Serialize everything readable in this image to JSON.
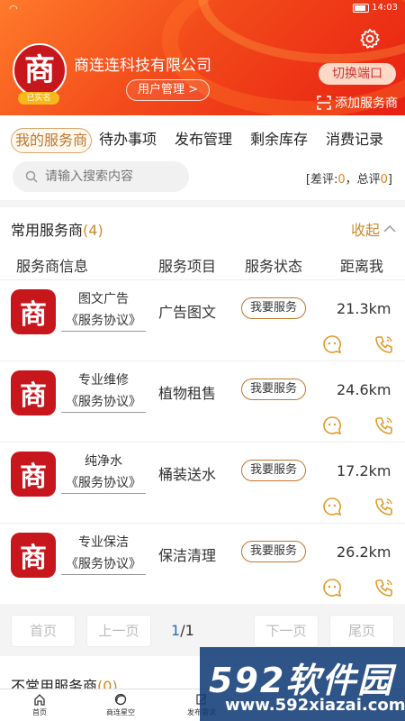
{
  "statusbar": {
    "time": "14:03"
  },
  "header": {
    "company_name": "商连连科技有限公司",
    "logo_char": "商",
    "verified_label": "已实名",
    "role_button": "用户管理 >",
    "switch_button": "切换端口",
    "add_provider": "添加服务商"
  },
  "tabs": [
    {
      "label": "我的服务商",
      "active": true
    },
    {
      "label": "待办事项"
    },
    {
      "label": "发布管理"
    },
    {
      "label": "剩余库存"
    },
    {
      "label": "消费记录"
    }
  ],
  "search": {
    "placeholder": "请输入搜索内容",
    "eval_prefix": "[差评:",
    "bad_count": "0",
    "eval_mid": "，总评",
    "total_count": "0",
    "eval_suffix": "]"
  },
  "common_section": {
    "title": "常用服务商",
    "count_text": "(4)",
    "collapse_label": "收起",
    "columns": [
      "服务商信息",
      "服务项目",
      "服务状态",
      "距离我"
    ],
    "rows": [
      {
        "logo_char": "商",
        "name": "图文广告",
        "agreement": "《服务协议》",
        "service": "广告图文",
        "status_button": "我要服务",
        "distance": "21.3km"
      },
      {
        "logo_char": "商",
        "name": "专业维修",
        "agreement": "《服务协议》",
        "service": "植物租售",
        "status_button": "我要服务",
        "distance": "24.6km"
      },
      {
        "logo_char": "商",
        "name": "纯净水",
        "agreement": "《服务协议》",
        "service": "桶装送水",
        "status_button": "我要服务",
        "distance": "17.2km"
      },
      {
        "logo_char": "商",
        "name": "专业保洁",
        "agreement": "《服务协议》",
        "service": "保洁清理",
        "status_button": "我要服务",
        "distance": "26.2km"
      }
    ]
  },
  "pager": {
    "first": "首页",
    "prev": "上一页",
    "current": "1",
    "total": "/1",
    "next": "下一页",
    "last": "尾页"
  },
  "uncommon_section": {
    "title": "不常用服务商",
    "count_text": "(0)"
  },
  "bottom_nav": [
    {
      "label": "首页",
      "icon": "home-icon"
    },
    {
      "label": "商连星空",
      "icon": "planet-icon"
    },
    {
      "label": "发布需求",
      "icon": "edit-icon"
    }
  ],
  "watermark": {
    "big_text": "592软件园",
    "url": "www.592xiazai.com"
  }
}
